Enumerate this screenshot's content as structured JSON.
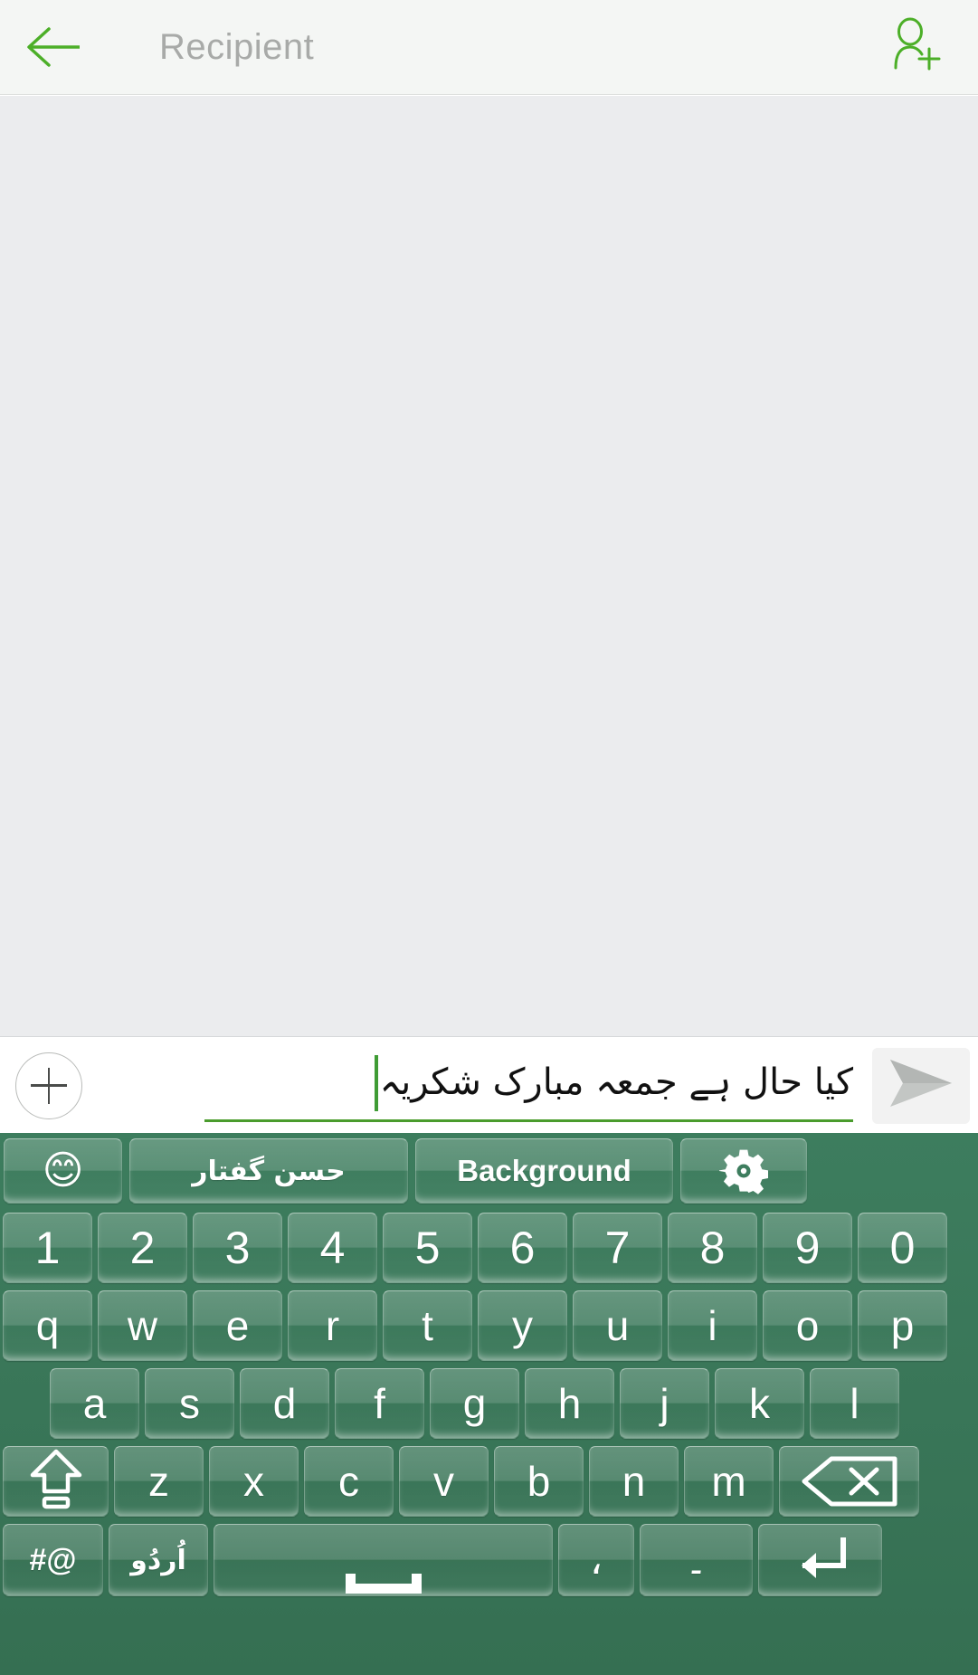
{
  "topbar": {
    "back_icon": "back-arrow-icon",
    "recipient_placeholder": "Recipient",
    "add_contact_icon": "add-contact-icon",
    "accent_color": "#4caf28",
    "background_color": "#f4f6f4",
    "placeholder_color": "#a8aaa8"
  },
  "body": {
    "background_color": "#ebecee",
    "content": ""
  },
  "compose": {
    "attach_icon": "plus-circle-icon",
    "message_value": "کیا حال ہے جمعہ مبارک شکریہ",
    "message_placeholder": "",
    "caret_color": "#3f9c35",
    "underline_color": "#4a9c2d",
    "send_icon": "send-paper-plane-icon",
    "send_enabled": false,
    "send_color": "#bfbfbf"
  },
  "keyboard": {
    "background_color": "#3d7d5e",
    "key_text_color": "#ffffff",
    "toolbar": [
      {
        "name": "emoji",
        "label": "😊",
        "icon": "emoji-smiley-icon"
      },
      {
        "name": "husn-e-guftar",
        "label": "حسن گفتار",
        "icon": ""
      },
      {
        "name": "background",
        "label": "Background",
        "icon": ""
      },
      {
        "name": "settings",
        "label": "",
        "icon": "gear-icon"
      }
    ],
    "rows": {
      "numbers": [
        "1",
        "2",
        "3",
        "4",
        "5",
        "6",
        "7",
        "8",
        "9",
        "0"
      ],
      "top": [
        "q",
        "w",
        "e",
        "r",
        "t",
        "y",
        "u",
        "i",
        "o",
        "p"
      ],
      "home": [
        "a",
        "s",
        "d",
        "f",
        "g",
        "h",
        "j",
        "k",
        "l"
      ],
      "bottom": [
        "z",
        "x",
        "c",
        "v",
        "b",
        "n",
        "m"
      ]
    },
    "special": {
      "shift": {
        "label": "",
        "icon": "shift-up-arrow-icon"
      },
      "backspace": {
        "label": "",
        "icon": "backspace-delete-icon"
      },
      "symbols": {
        "label": "#@",
        "icon": ""
      },
      "language": {
        "label": "اُردُو",
        "icon": ""
      },
      "space": {
        "label": "",
        "icon": "spacebar-icon"
      },
      "comma": {
        "label": "،",
        "icon": ""
      },
      "period": {
        "label": "۔",
        "icon": ""
      },
      "enter": {
        "label": "",
        "icon": "enter-return-icon"
      }
    }
  }
}
